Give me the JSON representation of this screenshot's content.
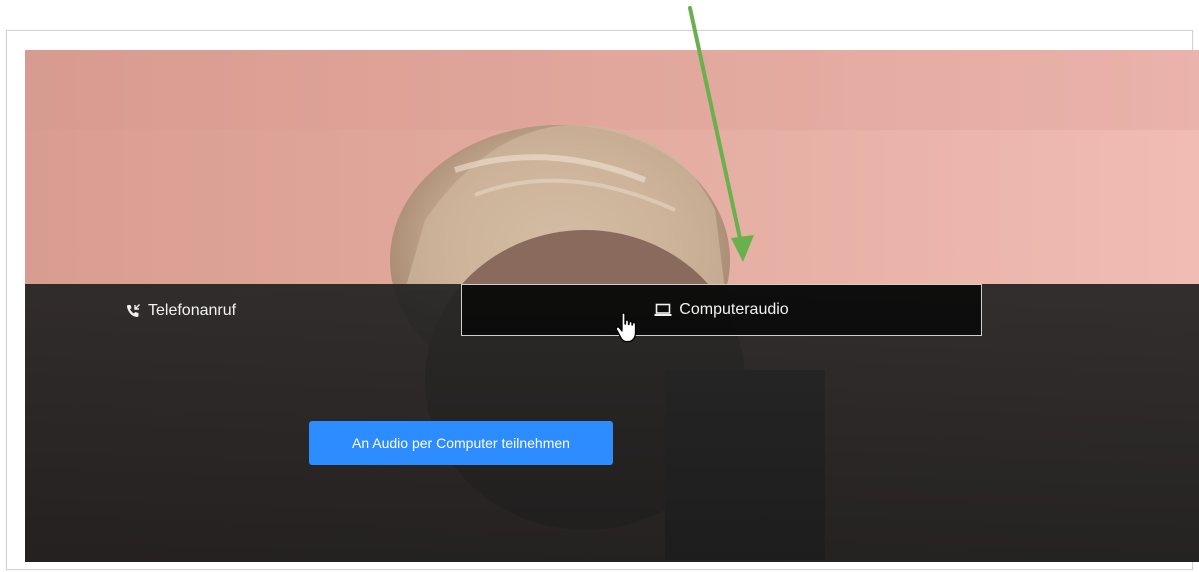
{
  "tabs": {
    "phone_label": "Telefonanruf",
    "computer_label": "Computeraudio"
  },
  "join_button_label": "An Audio per Computer teilnehmen",
  "colors": {
    "accent_blue": "#2d8cff",
    "annotation_arrow": "#6ab04c"
  },
  "icons": {
    "phone": "phone-call-icon",
    "computer": "laptop-icon"
  }
}
